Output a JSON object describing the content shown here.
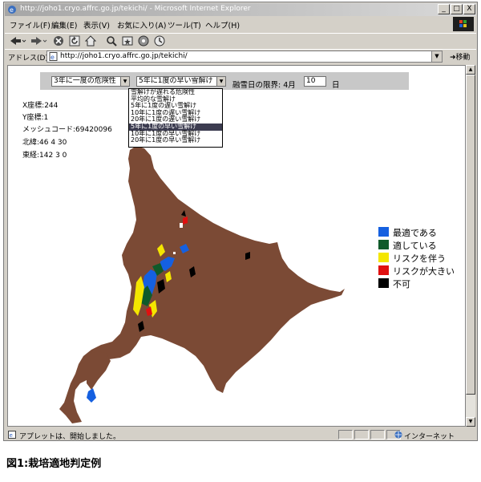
{
  "browser": {
    "title": "http://joho1.cryo.affrc.go.jp/tekichi/ - Microsoft Internet Explorer",
    "window_buttons": [
      "_",
      "□",
      "X"
    ],
    "menu": [
      "ファイル(F)",
      "編集(E)",
      "表示(V)",
      "お気に入り(A)",
      "ツール(T)",
      "ヘルプ(H)"
    ],
    "address_label": "アドレス(D)",
    "address_url": "http://joho1.cryo.affrc.go.jp/tekichi/",
    "go_label": "移動",
    "status_text": "アプレットは、開始しました。",
    "zone_text": "インターネット"
  },
  "applet": {
    "risk_select": "3年に一度の危険性",
    "melt_select": "5年に1度の早い雪解け",
    "limit_label": "融雪日の限界: 4月",
    "day_value": "10",
    "day_unit": "日",
    "dropdown_options": [
      "雪解けが遅れる危険性",
      "平均的な雪解け",
      "5年に1度の遅い雪解け",
      "10年に1度の遅い雪解け",
      "20年に1度の遅い雪解け",
      "5年に1度の早い雪解け",
      "10年に1度の早い雪解け",
      "20年に1度の早い雪解け"
    ],
    "selected_option_index": 5,
    "info": {
      "x": "X座標:244",
      "y": "Y座標:1",
      "mesh": "メッシュコード:69420096",
      "lat": "北緯:46 4 30",
      "lon": "東経:142 3 0"
    },
    "legend": [
      {
        "label": "最適である",
        "color": "#1560e0"
      },
      {
        "label": "適している",
        "color": "#0f5a2a"
      },
      {
        "label": "リスクを伴う",
        "color": "#f4e600"
      },
      {
        "label": "リスクが大きい",
        "color": "#e01010"
      },
      {
        "label": "不可",
        "color": "#000000"
      }
    ],
    "land_color": "#7b4a35"
  },
  "caption": "図1:栽培適地判定例"
}
